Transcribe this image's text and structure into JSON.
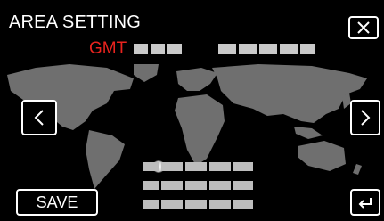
{
  "screen": {
    "title": "AREA SETTING",
    "gmt_label": "GMT",
    "save_label": "SAVE"
  },
  "icons": {
    "close": "close-icon",
    "prev": "chevron-left-icon",
    "next": "chevron-right-icon",
    "back": "return-arrow-icon"
  },
  "colors": {
    "background": "#000000",
    "gmt_label": "#e8231e",
    "map_land": "#6f6f6f",
    "text": "#ffffff"
  }
}
